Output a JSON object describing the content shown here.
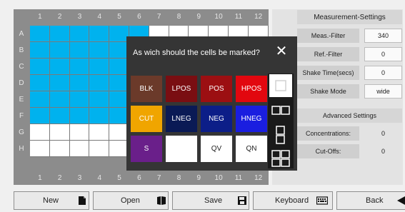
{
  "plate": {
    "columns": [
      "1",
      "2",
      "3",
      "4",
      "5",
      "6",
      "7",
      "8",
      "9",
      "10",
      "11",
      "12"
    ],
    "rows": [
      "A",
      "B",
      "C",
      "D",
      "E",
      "F",
      "G",
      "H"
    ],
    "marked_wells": {
      "A": [
        1,
        2,
        3,
        4,
        5,
        6
      ],
      "B": [
        1,
        2,
        3,
        4,
        5
      ],
      "C": [
        1,
        2,
        3,
        4,
        5
      ],
      "D": [
        1,
        2,
        3,
        4,
        5
      ],
      "E": [
        1,
        2,
        3,
        4,
        5
      ],
      "F": [
        1,
        2,
        3,
        4,
        5
      ]
    },
    "marked_color": "#00b2ee",
    "empty_color": "#ffffff"
  },
  "settings": {
    "title": "Measurement-Settings",
    "fields": [
      {
        "label": "Meas.-Filter",
        "value": "340"
      },
      {
        "label": "Ref.-Filter",
        "value": "0"
      },
      {
        "label": "Shake Time(secs)",
        "value": "0"
      },
      {
        "label": "Shake Mode",
        "value": "wide"
      }
    ],
    "advanced_title": "Advanced Settings",
    "advanced_fields": [
      {
        "label": "Concentrations:",
        "value": "0"
      },
      {
        "label": "Cut-Offs:",
        "value": "0"
      }
    ]
  },
  "dialog": {
    "title": "As wich should the cells be marked?",
    "close_icon": "close-x-icon",
    "buttons": [
      [
        {
          "label": "BLK",
          "bg": "#6b3a2a",
          "fg": "#ffffff"
        },
        {
          "label": "LPOS",
          "bg": "#7a0e12",
          "fg": "#ffffff"
        },
        {
          "label": "POS",
          "bg": "#9c0f12",
          "fg": "#ffffff"
        },
        {
          "label": "HPOS",
          "bg": "#e2070f",
          "fg": "#ffffff"
        }
      ],
      [
        {
          "label": "CUT",
          "bg": "#f0a500",
          "fg": "#ffffff"
        },
        {
          "label": "LNEG",
          "bg": "#0a1a55",
          "fg": "#ffffff"
        },
        {
          "label": "NEG",
          "bg": "#0c1e88",
          "fg": "#ffffff"
        },
        {
          "label": "HNEG",
          "bg": "#1a1ee0",
          "fg": "#ffffff"
        }
      ],
      [
        {
          "label": "S",
          "bg": "#6a1f8a",
          "fg": "#ffffff"
        },
        {
          "label": "",
          "bg": "#ffffff",
          "fg": "#222222"
        },
        {
          "label": "QV",
          "bg": "#ffffff",
          "fg": "#222222"
        },
        {
          "label": "QN",
          "bg": "#ffffff",
          "fg": "#222222"
        }
      ]
    ],
    "layout_icons": [
      "single-cell-icon",
      "two-cells-icon",
      "vertical-two-cells-icon",
      "four-cells-icon"
    ]
  },
  "footer": {
    "buttons": [
      {
        "label": "New",
        "icon": "new-file-icon"
      },
      {
        "label": "Open",
        "icon": "open-book-icon"
      },
      {
        "label": "Save",
        "icon": "save-disk-icon"
      },
      {
        "label": "Keyboard",
        "icon": "keyboard-icon"
      },
      {
        "label": "Back",
        "icon": "back-arrow-icon"
      }
    ]
  },
  "colors": {
    "plate_bg": "#8c8c8c",
    "dialog_bg": "#353535",
    "accent_blue": "#00b2ee"
  }
}
